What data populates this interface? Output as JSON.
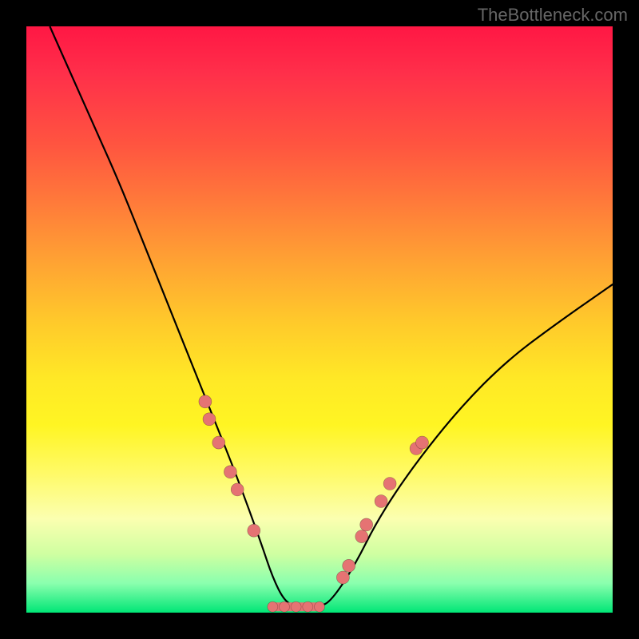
{
  "watermark": "TheBottleneck.com",
  "colors": {
    "background": "#000000",
    "gradient_top": "#ff1744",
    "gradient_mid": "#ffe826",
    "gradient_bottom": "#00e676",
    "curve": "#000000",
    "markers": "#e57373"
  },
  "chart_data": {
    "type": "line",
    "title": "",
    "xlabel": "",
    "ylabel": "",
    "xlim": [
      0,
      100
    ],
    "ylim": [
      0,
      100
    ],
    "series": [
      {
        "name": "curve",
        "x": [
          4,
          8,
          12,
          16,
          20,
          24,
          28,
          32,
          36,
          40,
          42,
          44,
          46,
          50,
          52,
          56,
          60,
          66,
          74,
          82,
          90,
          100
        ],
        "y": [
          100,
          91,
          82,
          73,
          63,
          53,
          43,
          33,
          23,
          12,
          6,
          2,
          1,
          1,
          2,
          8,
          16,
          25,
          35,
          43,
          49,
          56
        ]
      }
    ],
    "markers_left": [
      {
        "x": 30.5,
        "y": 36
      },
      {
        "x": 31.2,
        "y": 33
      },
      {
        "x": 32.8,
        "y": 29
      },
      {
        "x": 34.8,
        "y": 24
      },
      {
        "x": 36.0,
        "y": 21
      },
      {
        "x": 38.8,
        "y": 14
      }
    ],
    "markers_right": [
      {
        "x": 54.0,
        "y": 6
      },
      {
        "x": 55.0,
        "y": 8
      },
      {
        "x": 57.2,
        "y": 13
      },
      {
        "x": 58.0,
        "y": 15
      },
      {
        "x": 60.5,
        "y": 19
      },
      {
        "x": 62.0,
        "y": 22
      },
      {
        "x": 66.5,
        "y": 28
      },
      {
        "x": 67.5,
        "y": 29
      }
    ],
    "flat_segment": {
      "x0": 42,
      "x1": 50,
      "y": 1
    }
  }
}
